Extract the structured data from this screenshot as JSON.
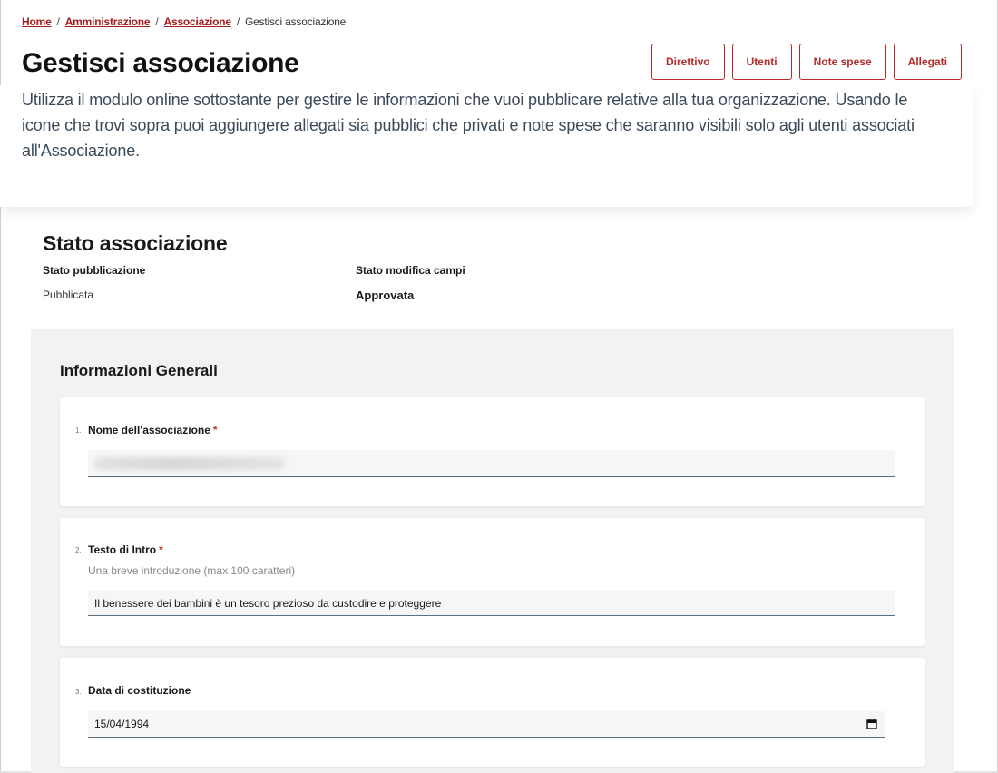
{
  "breadcrumb": {
    "items": [
      {
        "label": "Home"
      },
      {
        "label": "Amministrazione"
      },
      {
        "label": "Associazione"
      }
    ],
    "current": "Gestisci associazione",
    "separator": "/"
  },
  "page": {
    "title": "Gestisci associazione",
    "intro": "Utilizza il modulo online sottostante per gestire le informazioni che vuoi pubblicare relative alla tua organizzazione. Usando le icone che trovi sopra puoi aggiungere allegati sia pubblici che privati e note spese che saranno visibili solo agli utenti associati all'Associazione."
  },
  "actions": [
    {
      "label": "Direttivo"
    },
    {
      "label": "Utenti"
    },
    {
      "label": "Note spese"
    },
    {
      "label": "Allegati"
    }
  ],
  "status": {
    "title": "Stato associazione",
    "publication_label": "Stato pubblicazione",
    "publication_value": "Pubblicata",
    "edit_label": "Stato modifica campi",
    "edit_value": "Approvata"
  },
  "form": {
    "section_title": "Informazioni Generali",
    "fields": [
      {
        "number": "1.",
        "label": "Nome dell'associazione",
        "required_mark": "*",
        "value": ""
      },
      {
        "number": "2.",
        "label": "Testo di Intro",
        "required_mark": "*",
        "hint": "Una breve introduzione (max 100 caratteri)",
        "value": "Il benessere dei bambini è un tesoro prezioso da custodire e proteggere"
      },
      {
        "number": "3.",
        "label": "Data di costituzione",
        "value": "15/04/1994",
        "icon": "calendar-icon"
      }
    ]
  },
  "colors": {
    "accent": "#b52a2a",
    "link": "#a61c1c",
    "panel_bg": "#f2f2f2",
    "intro_text": "#3b4a59"
  }
}
